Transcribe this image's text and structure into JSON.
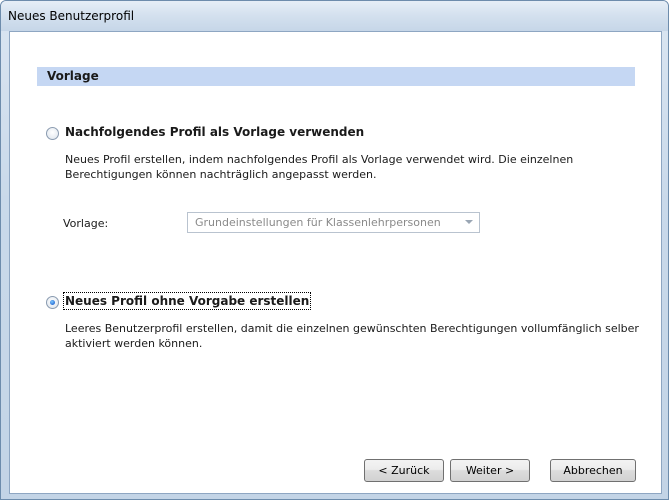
{
  "window": {
    "title": "Neues Benutzerprofil"
  },
  "section": {
    "title": "Vorlage"
  },
  "option_template": {
    "title": "Nachfolgendes Profil als Vorlage verwenden",
    "description": "Neues Profil erstellen, indem nachfolgendes Profil als Vorlage verwendet wird. Die einzelnen Berechtigungen können nachträglich angepasst werden.",
    "checked": false,
    "template_label": "Vorlage:",
    "template_value": "Grundeinstellungen für Klassenlehrpersonen",
    "template_enabled": false
  },
  "option_blank": {
    "title": "Neues Profil ohne Vorgabe erstellen",
    "description": "Leeres Benutzerprofil erstellen, damit die einzelnen gewünschten Berechtigungen vollumfänglich selber aktiviert werden können.",
    "checked": true
  },
  "buttons": {
    "back_label": "< Zurück",
    "next_label": "Weiter >",
    "cancel_label": "Abbrechen"
  }
}
